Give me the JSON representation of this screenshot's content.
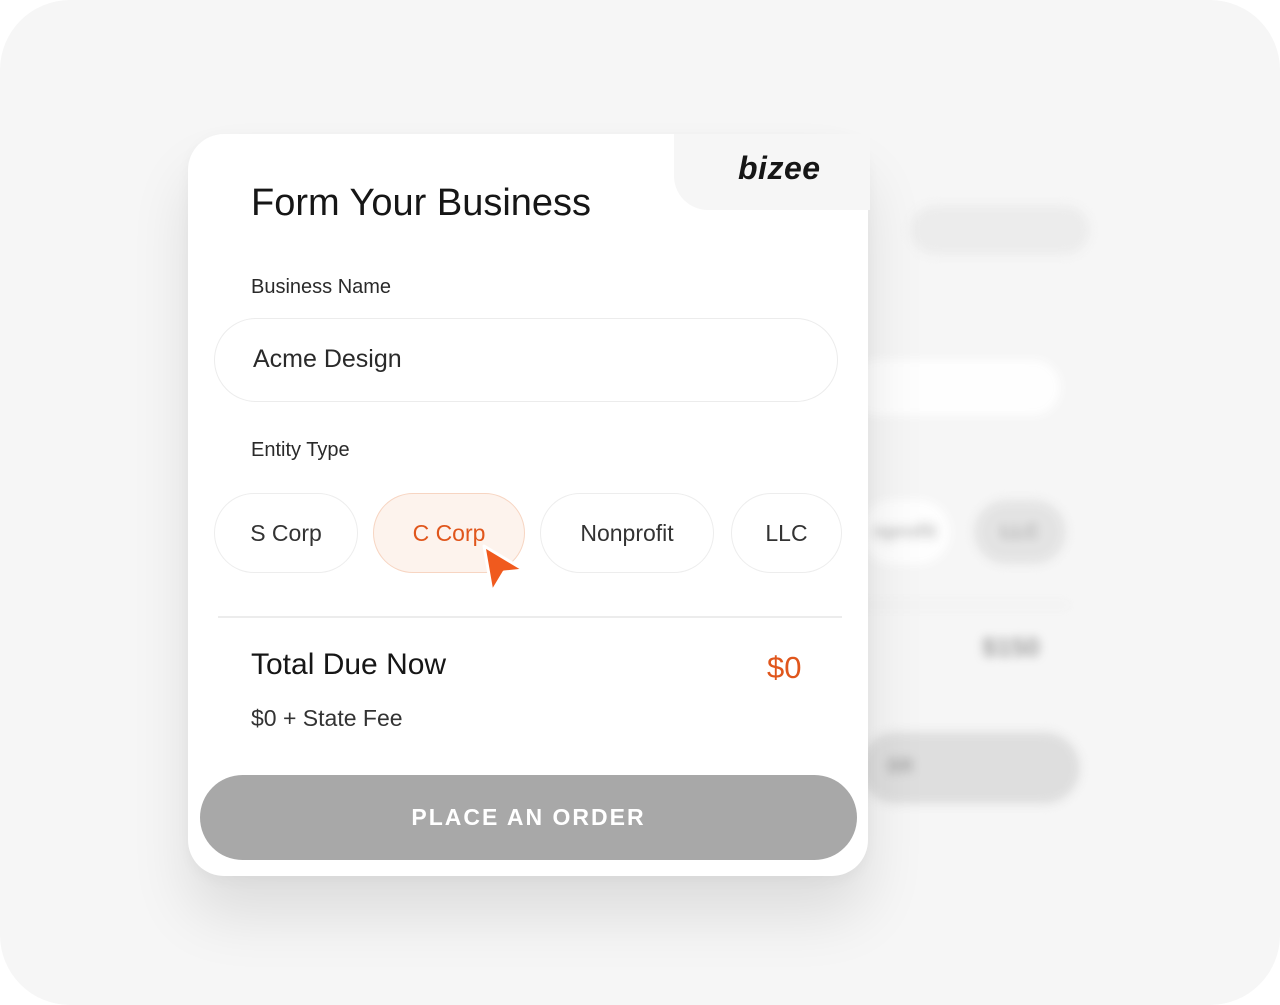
{
  "brand": {
    "logo_text": "bizee",
    "accent_color": "#e0561c"
  },
  "form": {
    "title": "Form Your Business",
    "business_name_label": "Business Name",
    "business_name_value": "Acme Design",
    "entity_type_label": "Entity Type",
    "entity_options": [
      "S Corp",
      "C Corp",
      "Nonprofit",
      "LLC"
    ],
    "selected_entity": "C Corp"
  },
  "summary": {
    "total_label": "Total Due Now",
    "total_value": "$0",
    "fee_note": "$0 + State Fee"
  },
  "actions": {
    "order_button": "PLACE AN ORDER"
  },
  "background_card": {
    "pill_left": "nprofit",
    "pill_right": "LLC",
    "price": "$150",
    "button_text": "ER"
  },
  "icons": {
    "cursor": "pointer-arrow-icon"
  }
}
